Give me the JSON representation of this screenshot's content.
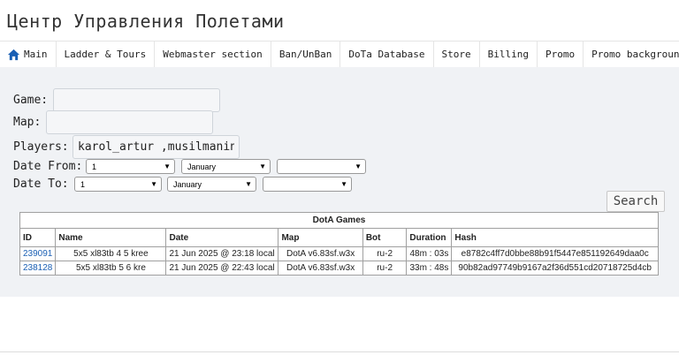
{
  "header": {
    "site_title": "Центр Управления Полетами"
  },
  "nav": {
    "items": [
      {
        "label": "Main",
        "icon": "home-icon"
      },
      {
        "label": "Ladder & Tours"
      },
      {
        "label": "Webmaster section"
      },
      {
        "label": "Ban/UnBan"
      },
      {
        "label": "DoTa Database"
      },
      {
        "label": "Store"
      },
      {
        "label": "Billing"
      },
      {
        "label": "Promo"
      },
      {
        "label": "Promo background"
      }
    ]
  },
  "form": {
    "game_label": "Game:",
    "game_value": "",
    "map_label": "Map:",
    "map_value": "",
    "players_label": "Players:",
    "players_value": "karol_artur ,musilmanin_",
    "date_from_label": "Date From:",
    "date_from": {
      "day": "1",
      "month": "January",
      "year": ""
    },
    "date_to_label": "Date To:",
    "date_to": {
      "day": "1",
      "month": "January",
      "year": ""
    },
    "search_label": "Search"
  },
  "games_table": {
    "caption": "DotA Games",
    "columns": [
      "ID",
      "Name",
      "Date",
      "Map",
      "Bot",
      "Duration",
      "Hash"
    ],
    "rows": [
      [
        "239091",
        "5x5 xl83tb 4 5 kree",
        "21 Jun 2025 @ 23:18 local",
        "DotA v6.83sf.w3x",
        "ru-2",
        "48m : 03s",
        "e8782c4ff7d0bbe88b91f5447e851192649daa0c"
      ],
      [
        "238128",
        "5x5 xl83tb 5 6 kre",
        "21 Jun 2025 @ 22:43 local",
        "DotA v6.83sf.w3x",
        "ru-2",
        "33m : 48s",
        "90b82ad97749b9167a2f36d551cd20718725d4cb"
      ]
    ]
  },
  "colors": {
    "accent": "#1a5fb4",
    "panel_bg": "#f0f2f5"
  }
}
